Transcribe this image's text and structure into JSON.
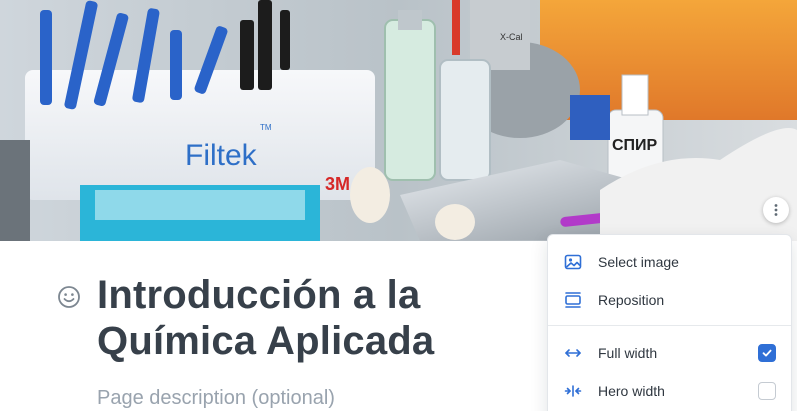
{
  "cover": {
    "image_alt": "Dental lab materials cover photo",
    "box_brand": "Filtek",
    "box_trademark": "TM",
    "box_brand2": "3M",
    "bottle_label": "СПИР",
    "machine_label": "X-Cal"
  },
  "page": {
    "title": "Introducción a la Química Aplicada",
    "description_placeholder": "Page description (optional)"
  },
  "menu": {
    "items": [
      {
        "label": "Select image",
        "icon": "image-icon"
      },
      {
        "label": "Reposition",
        "icon": "reposition-icon"
      }
    ],
    "width_options": [
      {
        "label": "Full width",
        "icon": "full-width-icon",
        "checked": true
      },
      {
        "label": "Hero width",
        "icon": "hero-width-icon",
        "checked": false
      }
    ]
  },
  "colors": {
    "accent": "#2f6fd6",
    "title": "#37404a",
    "placeholder": "#99a3ae"
  }
}
